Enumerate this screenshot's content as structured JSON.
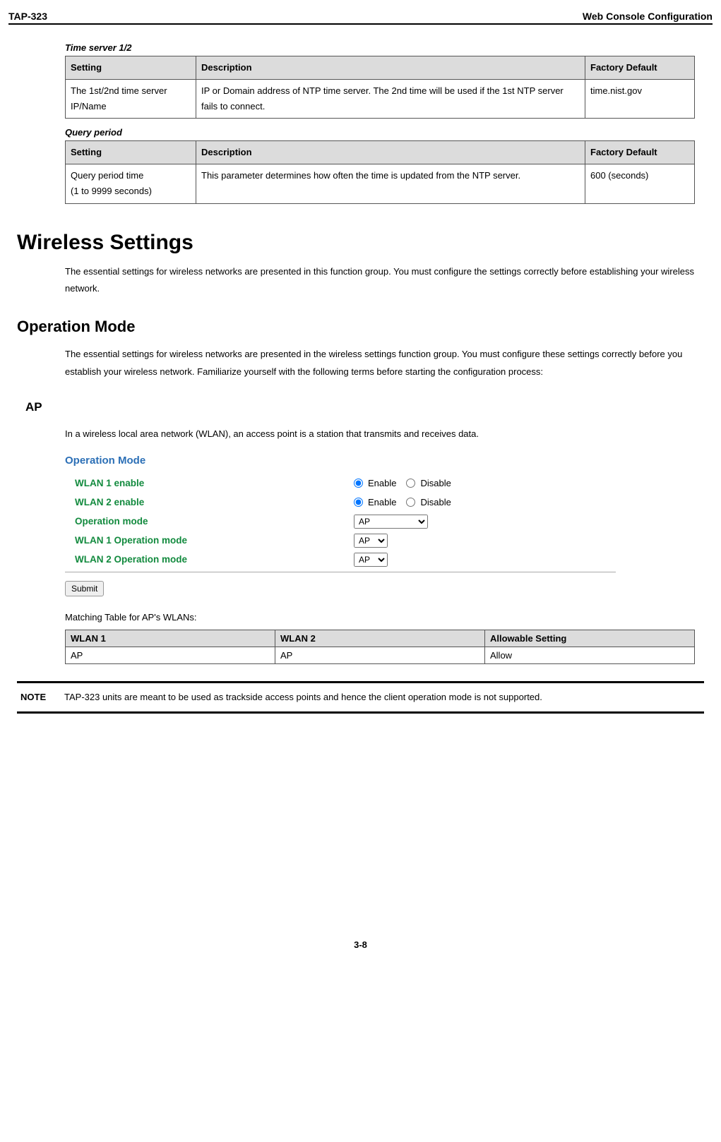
{
  "header": {
    "left": "TAP-323",
    "right": "Web Console Configuration"
  },
  "section1": {
    "title": "Time server 1/2",
    "cols": {
      "c1": "Setting",
      "c2": "Description",
      "c3": "Factory Default"
    },
    "row": {
      "setting": "The 1st/2nd time server IP/Name",
      "desc": "IP or Domain address of NTP time server. The 2nd time will be used if the 1st NTP server fails to connect.",
      "default": "time.nist.gov"
    }
  },
  "section2": {
    "title": "Query period",
    "cols": {
      "c1": "Setting",
      "c2": "Description",
      "c3": "Factory Default"
    },
    "row": {
      "setting_l1": "Query period time",
      "setting_l2": "(1 to 9999 seconds)",
      "desc": "This parameter determines how often the time is updated from the NTP server.",
      "default": "600 (seconds)"
    }
  },
  "wireless": {
    "heading": "Wireless Settings",
    "intro": "The essential settings for wireless networks are presented in this function group. You must configure the settings correctly before establishing your wireless network."
  },
  "opmode": {
    "heading": "Operation Mode",
    "intro": "The essential settings for wireless networks are presented in the wireless settings function group. You must configure these settings correctly before you establish your wireless network. Familiarize yourself with the following terms before starting the configuration process:",
    "ap_heading": "AP",
    "ap_intro": "In a wireless local area network (WLAN), an access point is a station that transmits and receives data.",
    "form": {
      "title": "Operation Mode",
      "rows": {
        "wlan1_enable": "WLAN 1 enable",
        "wlan2_enable": "WLAN 2 enable",
        "opmode": "Operation mode",
        "wlan1_op": "WLAN 1 Operation mode",
        "wlan2_op": "WLAN 2 Operation mode"
      },
      "radio": {
        "enable": "Enable",
        "disable": "Disable"
      },
      "select_ap": "AP",
      "submit": "Submit"
    },
    "matching_caption": "Matching Table for AP's WLANs:",
    "match_cols": {
      "c1": "WLAN 1",
      "c2": "WLAN 2",
      "c3": "Allowable Setting"
    },
    "match_row": {
      "v1": "AP",
      "v2": "AP",
      "v3": "Allow"
    }
  },
  "note": {
    "label": "NOTE",
    "text": "TAP-323 units are meant to be used as trackside access points and hence the client operation mode is not supported."
  },
  "footer": {
    "page": "3-8"
  }
}
